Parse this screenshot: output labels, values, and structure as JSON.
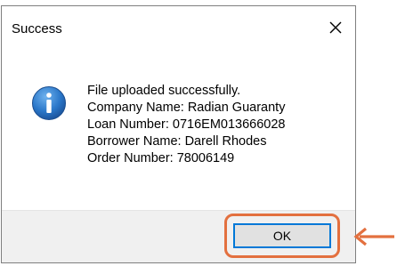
{
  "dialog": {
    "title": "Success",
    "message_lines": [
      "File uploaded successfully.",
      "Company Name: Radian Guaranty",
      "Loan Number: 0716EM013666028",
      "Borrower Name: Darell Rhodes",
      "Order Number: 78006149"
    ],
    "ok_label": "OK",
    "icons": {
      "close": "close-icon",
      "info": "info-icon"
    }
  },
  "annotation": {
    "color": "#e3703f",
    "arrow": "arrow-left-icon"
  }
}
